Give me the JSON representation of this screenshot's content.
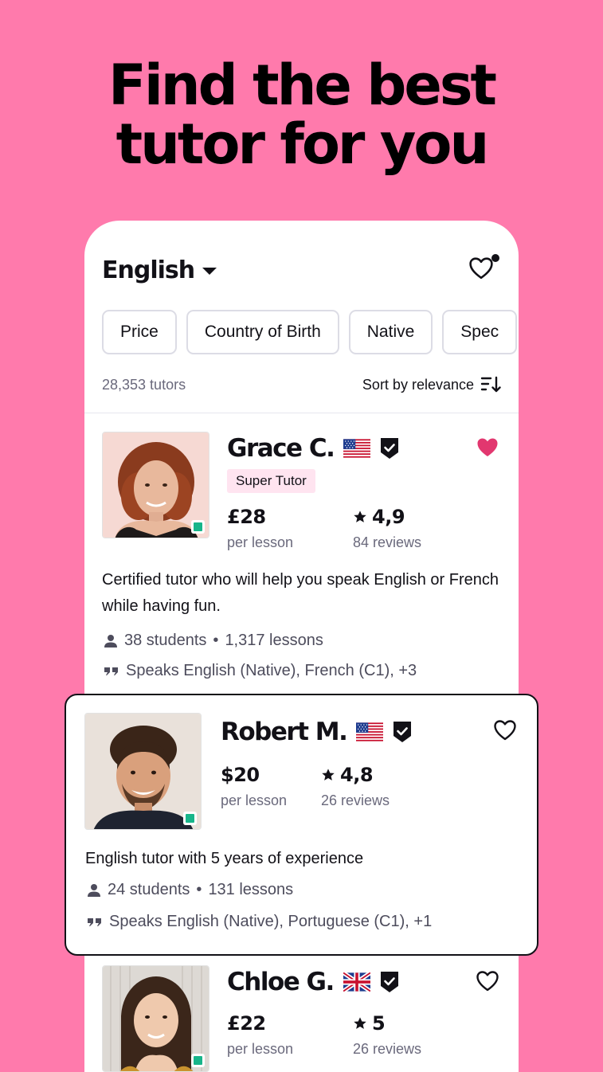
{
  "headline": {
    "line1": "Find the best",
    "line2": "tutor for you"
  },
  "header": {
    "language": "English",
    "favorites_icon": "heart-outline-icon"
  },
  "filters": [
    "Price",
    "Country of Birth",
    "Native",
    "Spec"
  ],
  "results": {
    "count": "28,353 tutors",
    "sort_label": "Sort by relevance"
  },
  "tutors": [
    {
      "name": "Grace C.",
      "flag": "us",
      "badge": "Super Tutor",
      "price": "£28",
      "price_unit": "per lesson",
      "rating": "4,9",
      "reviews": "84 reviews",
      "favorited": true,
      "description": "Certified tutor who will help you speak English or French while having fun.",
      "students": "38 students",
      "lessons": "1,317 lessons",
      "speaks": "Speaks English (Native), French (C1), +3"
    },
    {
      "name": "Robert M.",
      "flag": "us",
      "price": "$20",
      "price_unit": "per lesson",
      "rating": "4,8",
      "reviews": "26 reviews",
      "favorited": false,
      "description": "English tutor with 5 years of experience",
      "students": "24 students",
      "lessons": "131 lessons",
      "speaks": "Speaks English (Native), Portuguese (C1), +1"
    },
    {
      "name": "Chloe G.",
      "flag": "uk",
      "price": "£22",
      "price_unit": "per lesson",
      "rating": "5",
      "reviews": "26 reviews",
      "favorited": false
    }
  ],
  "colors": {
    "background": "#ff7aac",
    "favorite": "#e2376f",
    "online": "#17b58a",
    "super_badge_bg": "#ffe4f0"
  }
}
